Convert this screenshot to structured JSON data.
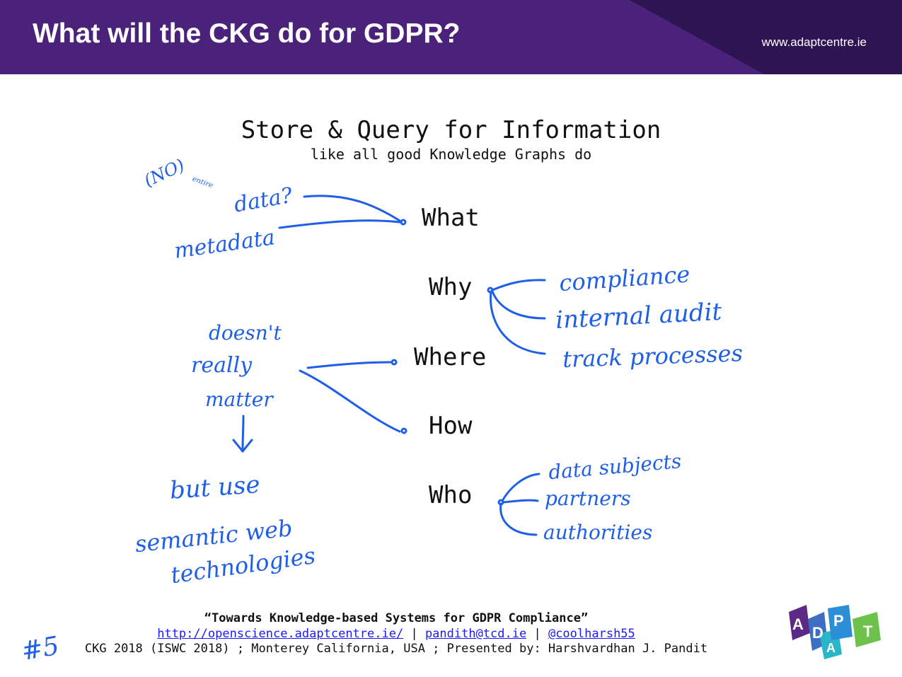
{
  "header": {
    "title": "What will the CKG do for GDPR?",
    "site": "www.adaptcentre.ie"
  },
  "content": {
    "heading": "Store & Query for Information",
    "subheading": "like all good Knowledge Graphs do",
    "questions": [
      "What",
      "Why",
      "Where",
      "How",
      "Who"
    ]
  },
  "annotations": {
    "no": "(NO)",
    "entire": "entire",
    "data": "data?",
    "metadata": "metadata",
    "compliance": "compliance",
    "internal_audit": "internal audit",
    "track_processes": "track processes",
    "doesnt": "doesn't",
    "really": "really",
    "matter": "matter",
    "but_use": "but use",
    "semantic_web": "semantic web",
    "technologies": "technologies",
    "data_subjects": "data subjects",
    "partners": "partners",
    "authorities": "authorities",
    "slide_number": "#5"
  },
  "footer": {
    "paper_title": "“Towards Knowledge-based Systems for GDPR Compliance”",
    "link_site": "http://openscience.adaptcentre.ie/",
    "sep1": " | ",
    "link_email": "pandith@tcd.ie",
    "sep2": " | ",
    "link_twitter": "@coolharsh55",
    "event": "CKG 2018 (ISWC 2018) ; Monterey California, USA ; Presented by: Harshvardhan J. Pandit"
  },
  "logo": {
    "letters": [
      "A",
      "D",
      "A",
      "P",
      "T"
    ],
    "colors": [
      "#5b2a86",
      "#3c6fc2",
      "#2bb5c9",
      "#2c8fd6",
      "#6cc24a"
    ]
  },
  "colors": {
    "header_bg": "#4a2279",
    "ink": "#1f5fe6"
  }
}
